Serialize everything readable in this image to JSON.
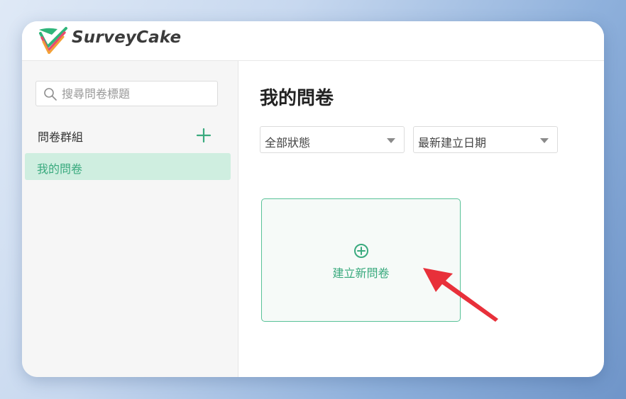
{
  "app": {
    "name": "SurveyCake"
  },
  "sidebar": {
    "search_placeholder": "搜尋問卷標題",
    "group_label": "問卷群組",
    "items": [
      {
        "label": "我的問卷",
        "active": true
      }
    ]
  },
  "main": {
    "title": "我的問卷",
    "filters": {
      "status": {
        "selected": "全部狀態"
      },
      "sort": {
        "selected": "最新建立日期"
      }
    },
    "new_survey_label": "建立新問卷"
  },
  "colors": {
    "accent": "#3aaa7e",
    "active_bg": "#cfeee0",
    "annotation_arrow": "#e8303a"
  },
  "icons": {
    "search": "search-icon",
    "add_group": "plus-icon",
    "dropdown": "chevron-down-icon",
    "new": "plus-circle-icon",
    "annotation": "arrow-annotation"
  }
}
